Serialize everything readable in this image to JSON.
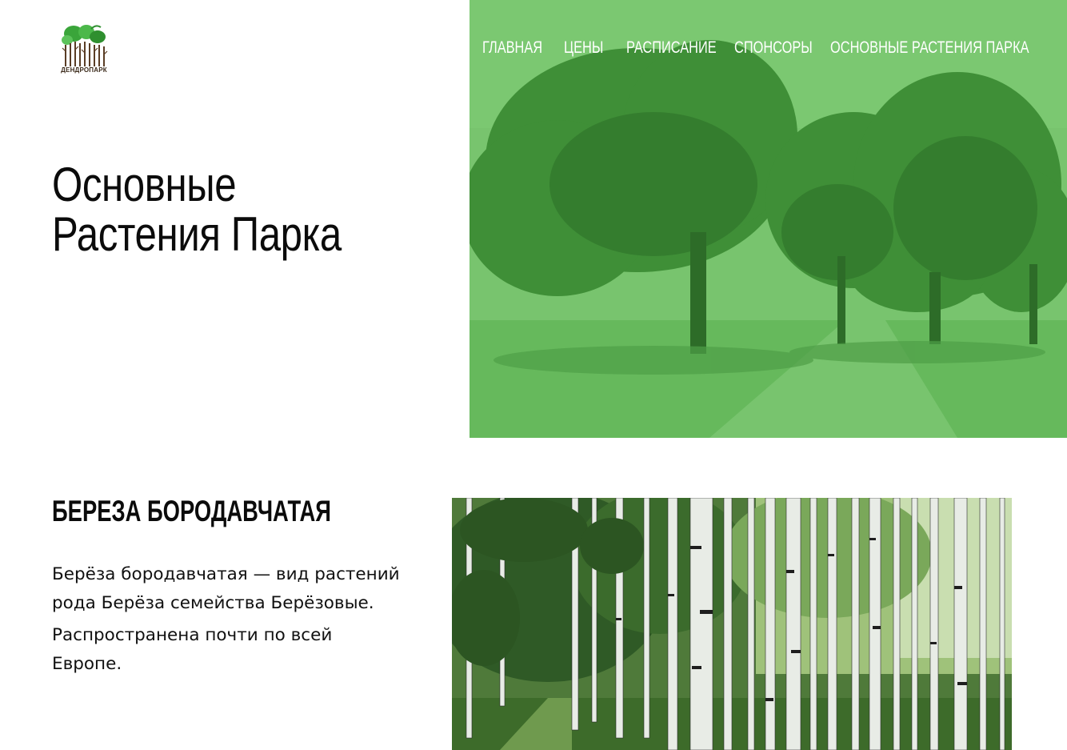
{
  "logo": {
    "text": "ДЕНДРОПАРК",
    "icon": "tree-logo-icon",
    "leaf_color": "#3aa53a",
    "trunk_color": "#5a3d25"
  },
  "nav": {
    "items": [
      {
        "label": "ГЛАВНАЯ"
      },
      {
        "label": "ЦЕНЫ"
      },
      {
        "label": "РАСПИСАНИЕ"
      },
      {
        "label": "СПОНСОРЫ"
      },
      {
        "label": "ОСНОВНЫЕ РАСТЕНИЯ ПАРКА"
      }
    ]
  },
  "hero": {
    "title_line1": "Основные",
    "title_line2": "Растения Парка",
    "overlay_color": "#5fc353"
  },
  "plant": {
    "title": "БЕРЕЗА БОРОДАВЧАТАЯ",
    "paragraph1": "Берёза бородавчатая — вид растений рода Берёза семейства Берёзовые.",
    "paragraph2": "Распространена почти по всей Европе."
  }
}
